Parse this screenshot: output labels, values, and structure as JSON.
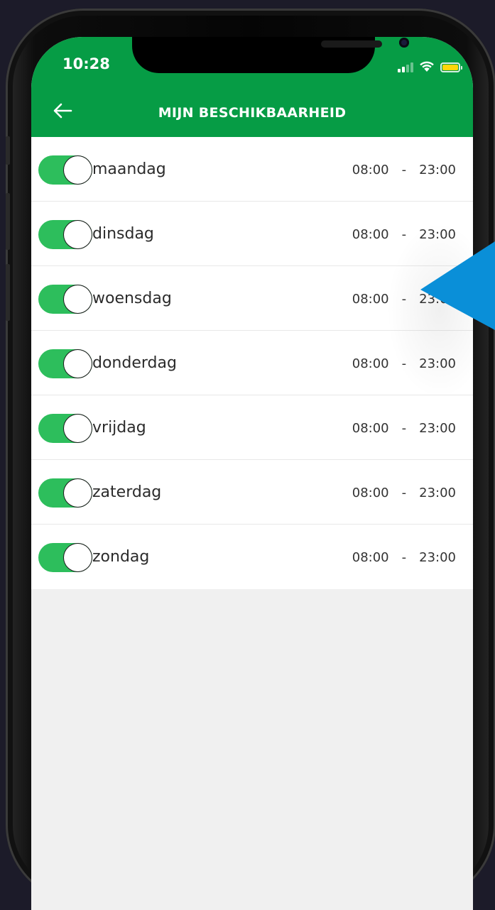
{
  "status_bar": {
    "time": "10:28"
  },
  "header": {
    "title": "MIJN BESCHIKBAARHEID",
    "back_icon": "arrow-left-icon"
  },
  "colors": {
    "header": "#069c45",
    "toggle_on": "#2dbe5c",
    "pointer": "#0a8fd8",
    "battery": "#ffd60a"
  },
  "days": [
    {
      "label": "maandag",
      "enabled": true,
      "start": "08:00",
      "separator": "-",
      "end": "23:00"
    },
    {
      "label": "dinsdag",
      "enabled": true,
      "start": "08:00",
      "separator": "-",
      "end": "23:00"
    },
    {
      "label": "woensdag",
      "enabled": true,
      "start": "08:00",
      "separator": "-",
      "end": "23:00"
    },
    {
      "label": "donderdag",
      "enabled": true,
      "start": "08:00",
      "separator": "-",
      "end": "23:00"
    },
    {
      "label": "vrijdag",
      "enabled": true,
      "start": "08:00",
      "separator": "-",
      "end": "23:00"
    },
    {
      "label": "zaterdag",
      "enabled": true,
      "start": "08:00",
      "separator": "-",
      "end": "23:00"
    },
    {
      "label": "zondag",
      "enabled": true,
      "start": "08:00",
      "separator": "-",
      "end": "23:00"
    }
  ]
}
